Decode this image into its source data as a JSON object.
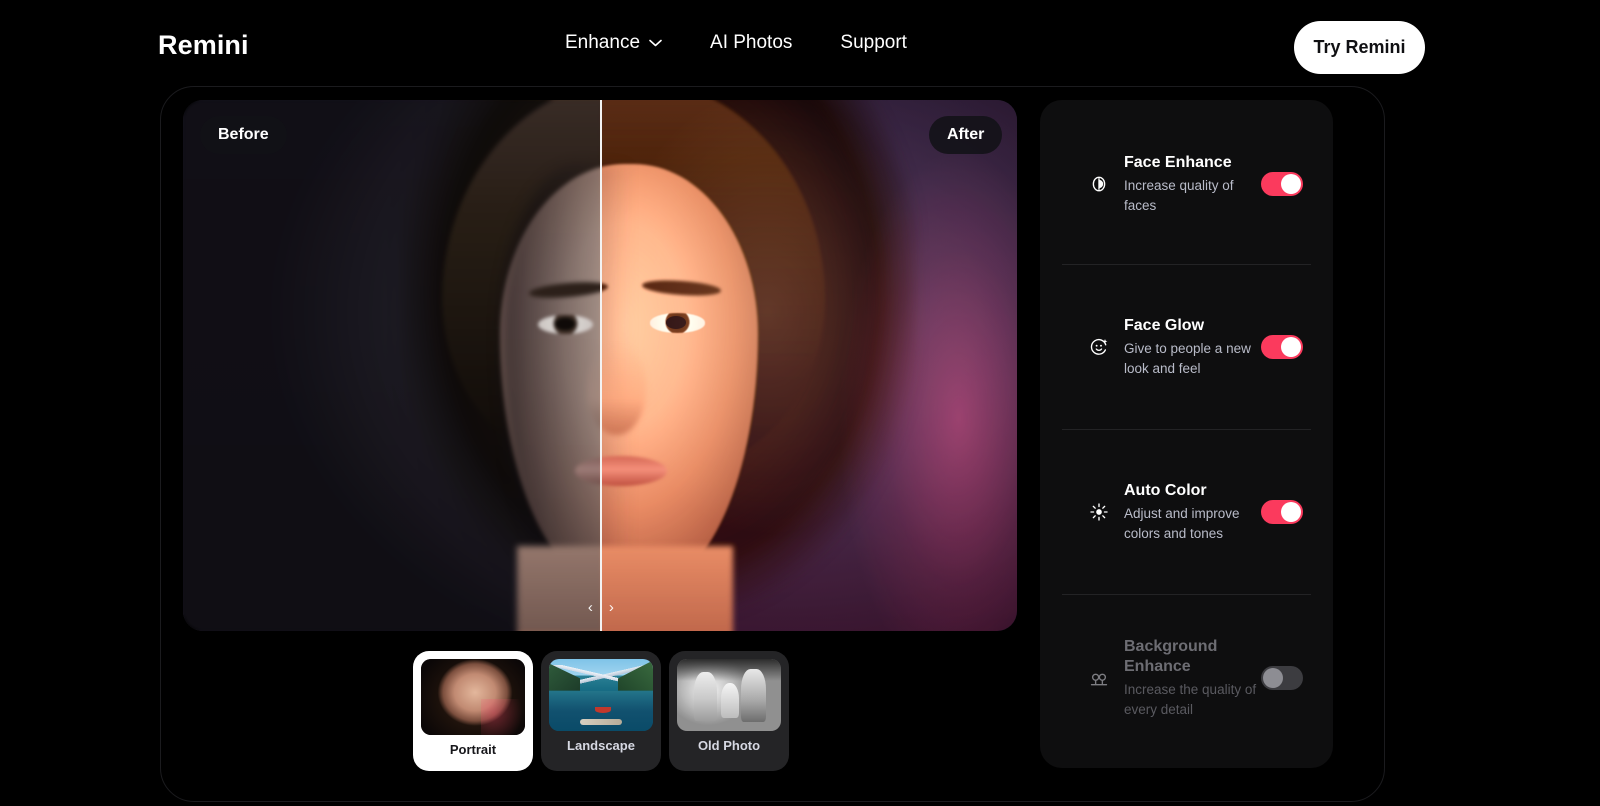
{
  "brand": "Remini",
  "nav": {
    "items": [
      {
        "label": "Enhance",
        "has_caret": true
      },
      {
        "label": "AI Photos",
        "has_caret": false
      },
      {
        "label": "Support",
        "has_caret": false
      }
    ],
    "cta": "Try Remini"
  },
  "preview": {
    "before_label": "Before",
    "after_label": "After",
    "slider_position_percent": 50,
    "handle_left_icon": "chevron-left-icon",
    "handle_right_icon": "chevron-right-icon"
  },
  "thumbnails": [
    {
      "label": "Portrait",
      "selected": true
    },
    {
      "label": "Landscape",
      "selected": false
    },
    {
      "label": "Old Photo",
      "selected": false
    }
  ],
  "settings": [
    {
      "title": "Face Enhance",
      "desc": "Increase quality of faces",
      "icon": "face-enhance-icon",
      "enabled": true
    },
    {
      "title": "Face Glow",
      "desc": "Give to people a new look and feel",
      "icon": "face-glow-icon",
      "enabled": true
    },
    {
      "title": "Auto Color",
      "desc": "Adjust and improve colors and tones",
      "icon": "auto-color-icon",
      "enabled": true
    },
    {
      "title": "Background Enhance",
      "desc": "Increase the quality of every detail",
      "icon": "background-enhance-icon",
      "enabled": false
    }
  ],
  "colors": {
    "page_bg": "#000000",
    "panel_bg": "#0e0e0f",
    "accent_on": "#fb3a5d",
    "toggle_off_track": "#3c3c40",
    "toggle_off_knob": "#8d8d93",
    "text_primary": "#ffffff",
    "text_secondary": "#b9bcc9",
    "divider": "#232325",
    "cta_bg": "#ffffff",
    "cta_text": "#101013"
  }
}
